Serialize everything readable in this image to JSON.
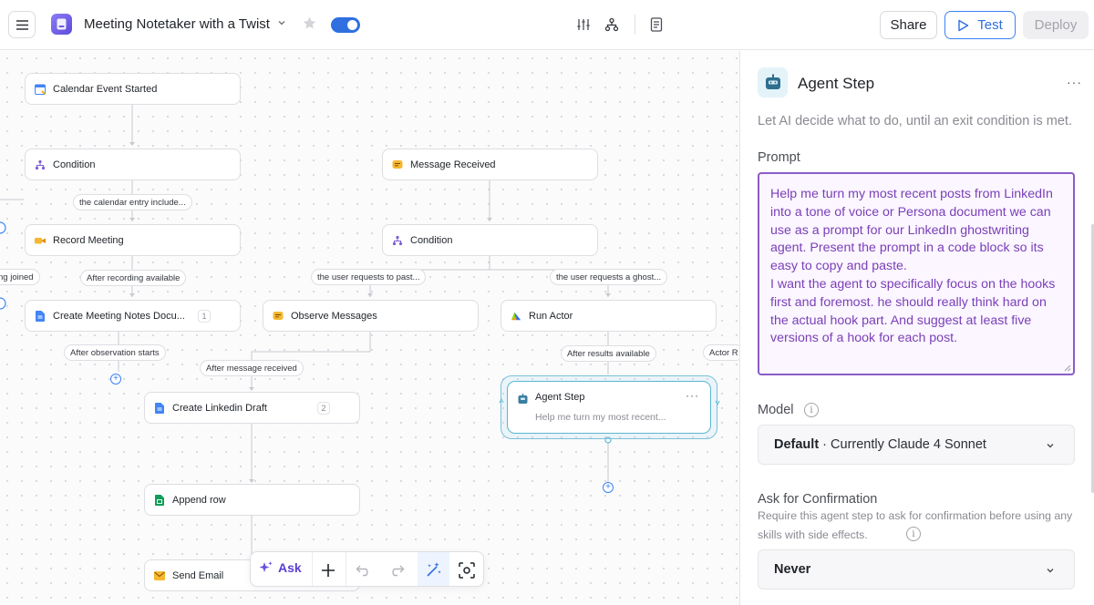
{
  "header": {
    "app_title": "Meeting Notetaker with a Twist",
    "share_label": "Share",
    "test_label": "Test",
    "deploy_label": "Deploy",
    "enabled": true,
    "accent_color": "#2f6fe0"
  },
  "canvas": {
    "nodes": {
      "calendar_event": "Calendar Event Started",
      "condition_1": "Condition",
      "message_received": "Message Received",
      "record_meeting": "Record Meeting",
      "condition_2": "Condition",
      "create_notes": "Create Meeting Notes Docu...",
      "create_notes_badge": "1",
      "observe_messages": "Observe Messages",
      "run_actor": "Run Actor",
      "create_linkedin": "Create Linkedin Draft",
      "create_linkedin_badge": "2",
      "append_row": "Append row",
      "send_email": "Send Email"
    },
    "edge_labels": {
      "calendar_entry": "the calendar entry include...",
      "bot_joined": "ng joined",
      "after_recording": "After recording available",
      "user_requests_past": "the user requests to past...",
      "user_requests_ghost": "the user requests a ghost...",
      "after_observation": "After observation starts",
      "after_message": "After message received",
      "after_results": "After results available",
      "actor_r": "Actor R"
    },
    "agent_node": {
      "title": "Agent Step",
      "subtitle": "Help me turn my most recent...",
      "more": "···"
    },
    "toolbar": {
      "ask_label": "Ask"
    }
  },
  "panel": {
    "title": "Agent Step",
    "more": "···",
    "description": "Let AI decide what to do, until an exit condition is met.",
    "prompt_label": "Prompt",
    "prompt_text": "Help me turn my most recent posts from LinkedIn into a tone of voice or Persona document we can use as a prompt for our LinkedIn ghostwriting agent. Present the prompt in a code block so its easy to copy and paste.\nI want the agent to specifically focus on the hooks first and foremost. he should really think hard on the actual hook part. And suggest at least five versions of a hook for each post.",
    "model_label": "Model",
    "model_value_bold": "Default",
    "model_value_rest": " · Currently Claude 4 Sonnet",
    "confirm_label": "Ask for Confirmation",
    "confirm_desc": "Require this agent step to ask for confirmation before using any skills with side effects.",
    "confirm_value": "Never",
    "prompt_color": "#8b5cc7"
  }
}
